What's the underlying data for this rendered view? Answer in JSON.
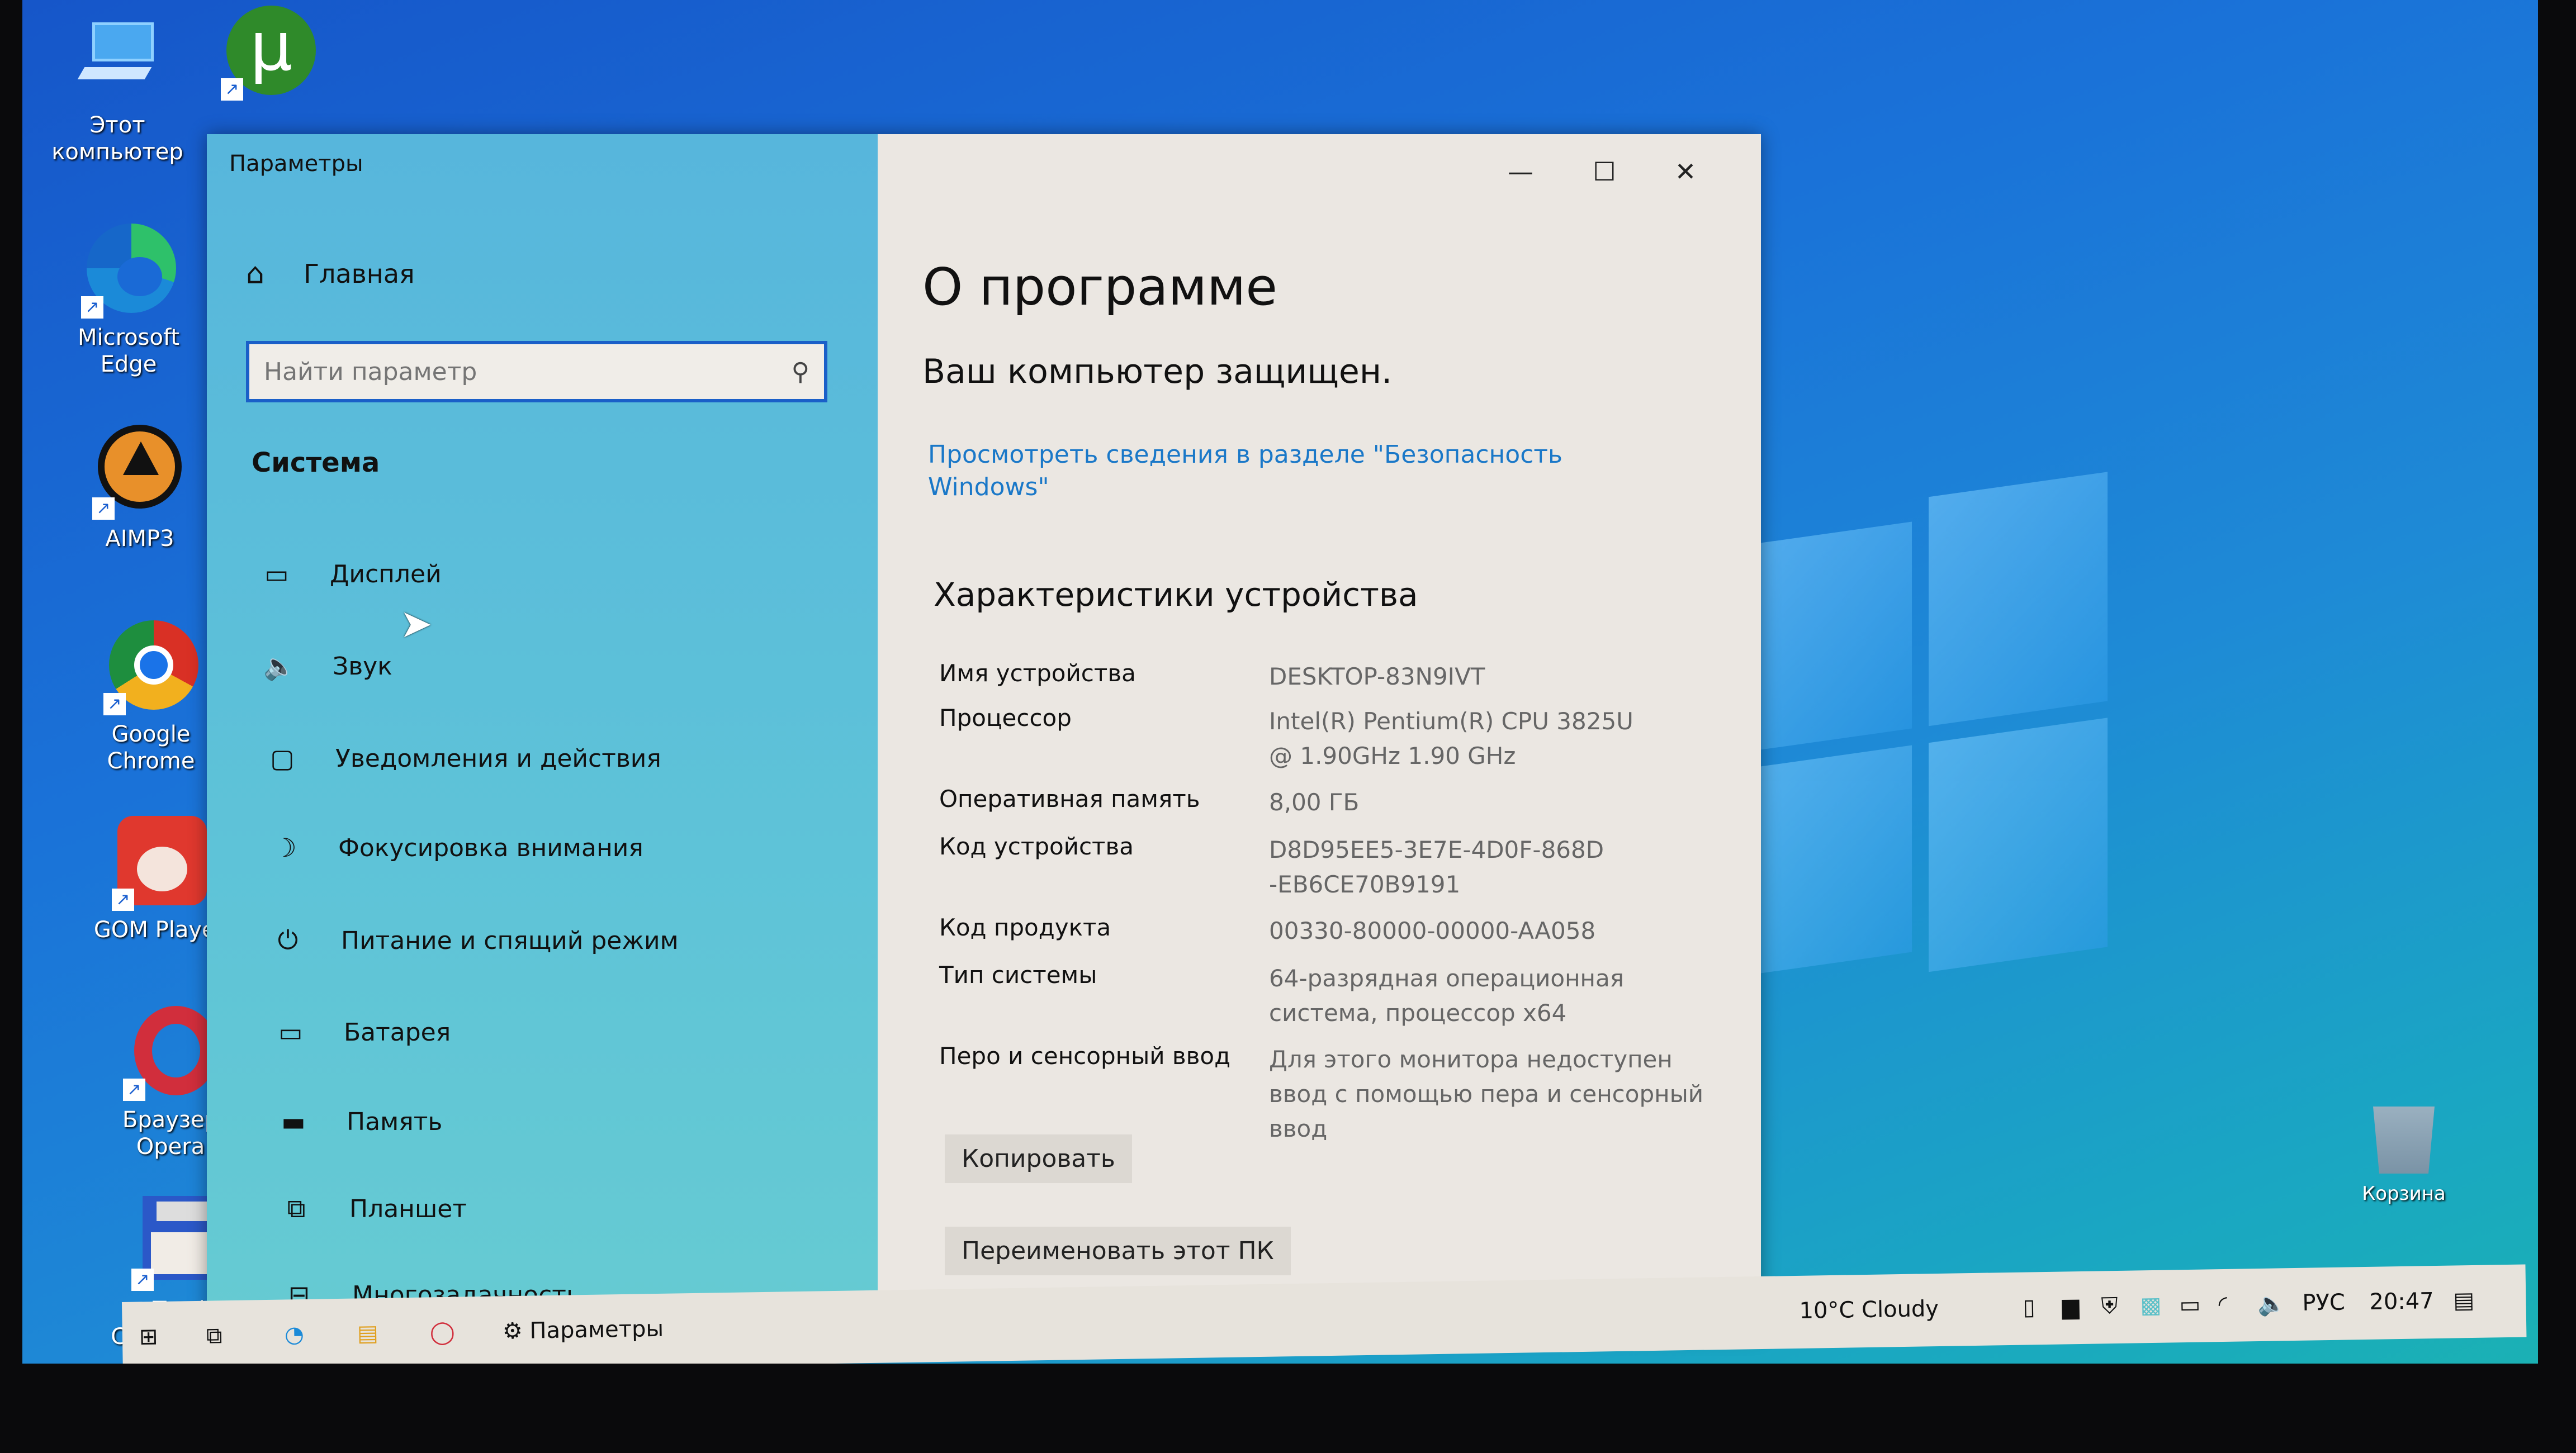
{
  "desktop": {
    "icons": [
      {
        "label": "Этот компьютер",
        "icon": "pc-icon"
      },
      {
        "label": "µTorrent",
        "icon": "utorrent-icon"
      },
      {
        "label": "Microsoft Edge",
        "icon": "edge-icon"
      },
      {
        "label": "AIMP3",
        "icon": "aimp-icon"
      },
      {
        "label": "Google Chrome",
        "icon": "chrome-icon"
      },
      {
        "label": "GOM Player",
        "icon": "gom-icon"
      },
      {
        "label": "Браузер Opera",
        "icon": "opera-icon"
      },
      {
        "label": "Total Command...",
        "icon": "floppy-icon"
      },
      {
        "label": "Корзина",
        "icon": "recycle-bin-icon"
      }
    ]
  },
  "window": {
    "title": "Параметры",
    "controls": {
      "minimize": "—",
      "maximize": "☐",
      "close": "✕"
    },
    "sidebar": {
      "home_label": "Главная",
      "search_placeholder": "Найти параметр",
      "section": "Система",
      "items": [
        {
          "label": "Дисплей",
          "icon": "display-icon"
        },
        {
          "label": "Звук",
          "icon": "speaker-icon"
        },
        {
          "label": "Уведомления и действия",
          "icon": "notification-icon"
        },
        {
          "label": "Фокусировка внимания",
          "icon": "moon-icon"
        },
        {
          "label": "Питание и спящий режим",
          "icon": "power-icon"
        },
        {
          "label": "Батарея",
          "icon": "battery-icon"
        },
        {
          "label": "Память",
          "icon": "storage-icon"
        },
        {
          "label": "Планшет",
          "icon": "tablet-icon"
        },
        {
          "label": "Многозадачность",
          "icon": "multitask-icon"
        }
      ]
    },
    "main": {
      "title": "О программе",
      "protected": "Ваш компьютер защищен.",
      "security_link": "Просмотреть сведения в разделе \"Безопасность Windows\"",
      "specs_heading": "Характеристики устройства",
      "specs": [
        {
          "label": "Имя устройства",
          "value": "DESKTOP-83N9IVT"
        },
        {
          "label": "Процессор",
          "value": "Intel(R) Pentium(R) CPU 3825U @ 1.90GHz   1.90 GHz"
        },
        {
          "label": "Оперативная память",
          "value": "8,00 ГБ"
        },
        {
          "label": "Код устройства",
          "value": "D8D95EE5-3E7E-4D0F-868D-EB6CE70B9191"
        },
        {
          "label": "Код продукта",
          "value": "00330-80000-00000-AA058"
        },
        {
          "label": "Тип системы",
          "value": "64-разрядная операционная система, процессор x64"
        },
        {
          "label": "Перо и сенсорный ввод",
          "value": "Для этого монитора недоступен ввод с помощью пера и сенсорный ввод"
        }
      ],
      "copy_button": "Копировать",
      "rename_button": "Переименовать этот ПК"
    }
  },
  "taskbar": {
    "active_app": "Параметры",
    "weather": "10°C  Cloudy",
    "language": "РУС",
    "time": "20:47"
  }
}
